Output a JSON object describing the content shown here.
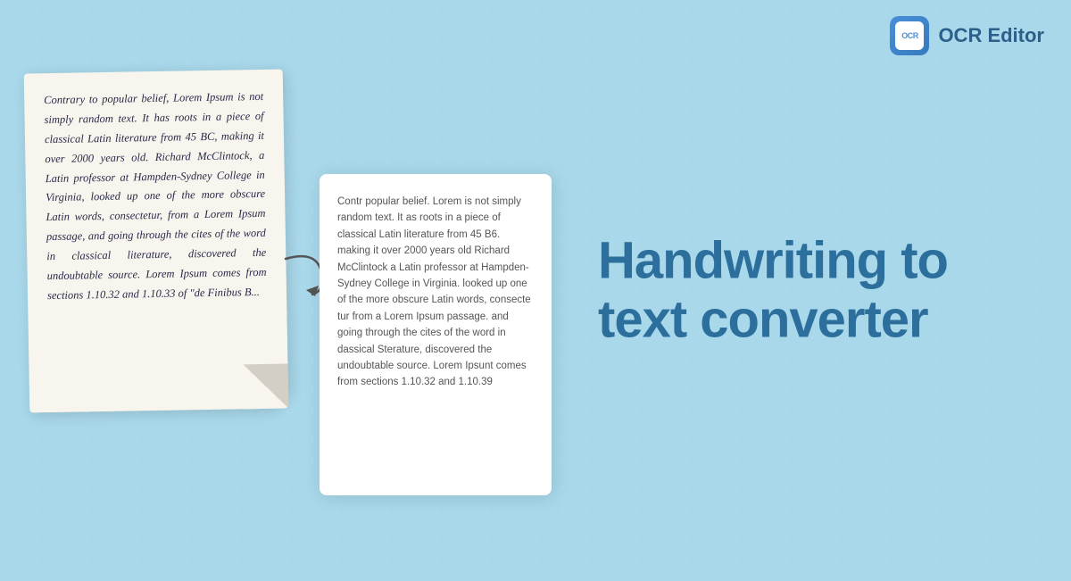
{
  "header": {
    "logo_text": "OCR",
    "app_title": "OCR Editor"
  },
  "handwritten": {
    "text": "Contrary to popular belief, Lorem Ipsum is not simply random text. It has roots in a piece of classical Latin literature from 45 BC, making it over 2000 years old. Richard McClintock, a Latin professor at Hampden-Sydney College in Virginia, looked up one of the more obscure Latin words, consectetur, from a Lorem Ipsum passage, and going through the cites of the word in classical literature, discovered the undoubtable source. Lorem Ipsum comes from sections 1.10.32 and 1.10.33 of \"de Finibus B..."
  },
  "ocr_output": {
    "text": "Contr popular belief. Lorem is not simply random text. It as roots in a piece of classical Latin literature from 45 B6. making it over 2000 years old Richard McClintock a Latin professor at Hampden-Sydney College in Virginia. looked up one of the more obscure Latin words, consecte tur from a Lorem Ipsum passage. and going through the cites of the word in dassical Sterature, discovered the undoubtable source. Lorem Ipsunt comes from sections 1.10.32 and 1.10.39"
  },
  "main_heading": {
    "line1": "Handwriting to",
    "line2": "text converter"
  }
}
